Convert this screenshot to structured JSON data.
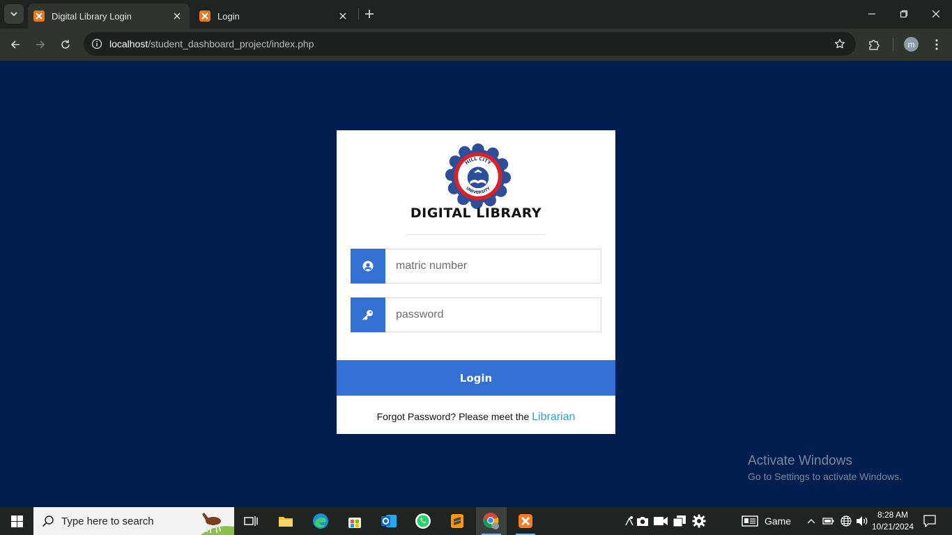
{
  "browser": {
    "tabs": [
      {
        "title": "Digital Library Login",
        "active": true
      },
      {
        "title": "Login",
        "active": false
      }
    ],
    "url_host": "localhost",
    "url_path": "/student_dashboard_project/index.php",
    "profile_initial": "m"
  },
  "login": {
    "brand": "DIGITAL LIBRARY",
    "logo_text_top": "HILL CITY",
    "logo_text_bottom": "UNIVERSITY",
    "matric_placeholder": "matric number",
    "password_placeholder": "password",
    "login_label": "Login",
    "forgot_text": "Forgot Password? Please meet the ",
    "librarian_link": "Librarian",
    "accent_color": "#3271d3",
    "background_color": "#001e4f"
  },
  "watermark": {
    "line1": "Activate Windows",
    "line2": "Go to Settings to activate Windows."
  },
  "taskbar": {
    "search_placeholder": "Type here to search",
    "game_label": "Game",
    "time": "8:28 AM",
    "date": "10/21/2024",
    "apps": [
      "task-view-icon",
      "file-explorer-icon",
      "edge-icon",
      "store-icon",
      "outlook-icon",
      "whatsapp-icon",
      "sublime-icon",
      "chrome-icon",
      "xampp-icon"
    ]
  }
}
